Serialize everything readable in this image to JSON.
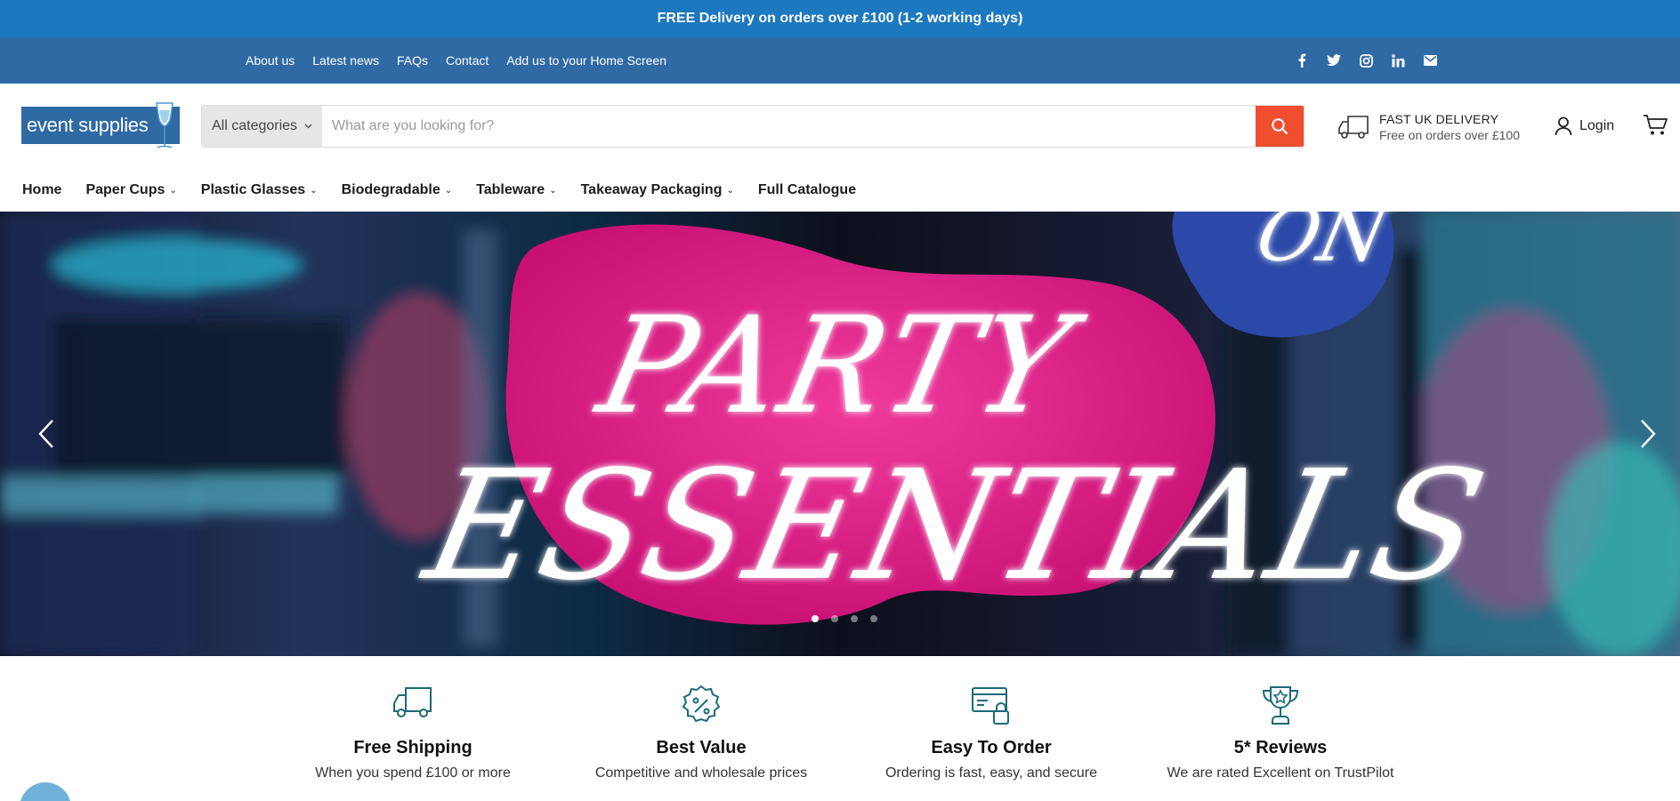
{
  "announcement": {
    "text": "FREE Delivery on orders over £100 (1-2 working days)"
  },
  "utility": {
    "links": [
      "About us",
      "Latest news",
      "FAQs",
      "Contact",
      "Add us to your Home Screen"
    ],
    "social": [
      "facebook-icon",
      "twitter-icon",
      "instagram-icon",
      "linkedin-icon",
      "email-icon"
    ]
  },
  "header": {
    "logo_text": "event supplies",
    "search": {
      "category_label": "All categories",
      "placeholder": "What are you looking for?"
    },
    "delivery": {
      "title": "FAST UK DELIVERY",
      "subtitle": "Free on orders over £100"
    },
    "login_label": "Login"
  },
  "nav": {
    "items": [
      {
        "label": "Home",
        "has_dropdown": false
      },
      {
        "label": "Paper Cups",
        "has_dropdown": true
      },
      {
        "label": "Plastic Glasses",
        "has_dropdown": true
      },
      {
        "label": "Biodegradable",
        "has_dropdown": true
      },
      {
        "label": "Tableware",
        "has_dropdown": true
      },
      {
        "label": "Takeaway Packaging",
        "has_dropdown": true
      },
      {
        "label": "Full Catalogue",
        "has_dropdown": false
      }
    ]
  },
  "hero": {
    "slide_word_top": "PARTY",
    "slide_word_bottom": "ESSENTIALS",
    "slide_word_corner": "ON",
    "slide_count": 4,
    "active_slide": 1
  },
  "features": [
    {
      "icon": "truck-icon",
      "title": "Free Shipping",
      "subtitle": "When you spend £100 or more"
    },
    {
      "icon": "discount-badge-icon",
      "title": "Best Value",
      "subtitle": "Competitive and wholesale prices"
    },
    {
      "icon": "secure-card-icon",
      "title": "Easy To Order",
      "subtitle": "Ordering is fast, easy, and secure"
    },
    {
      "icon": "trophy-icon",
      "title": "5* Reviews",
      "subtitle": "We are rated Excellent on TrustPilot"
    }
  ],
  "colors": {
    "announcement_bg": "#1c78bf",
    "utility_bg": "#2f6aa5",
    "search_button": "#f04e2f",
    "feature_icon": "#1a6b7a"
  }
}
